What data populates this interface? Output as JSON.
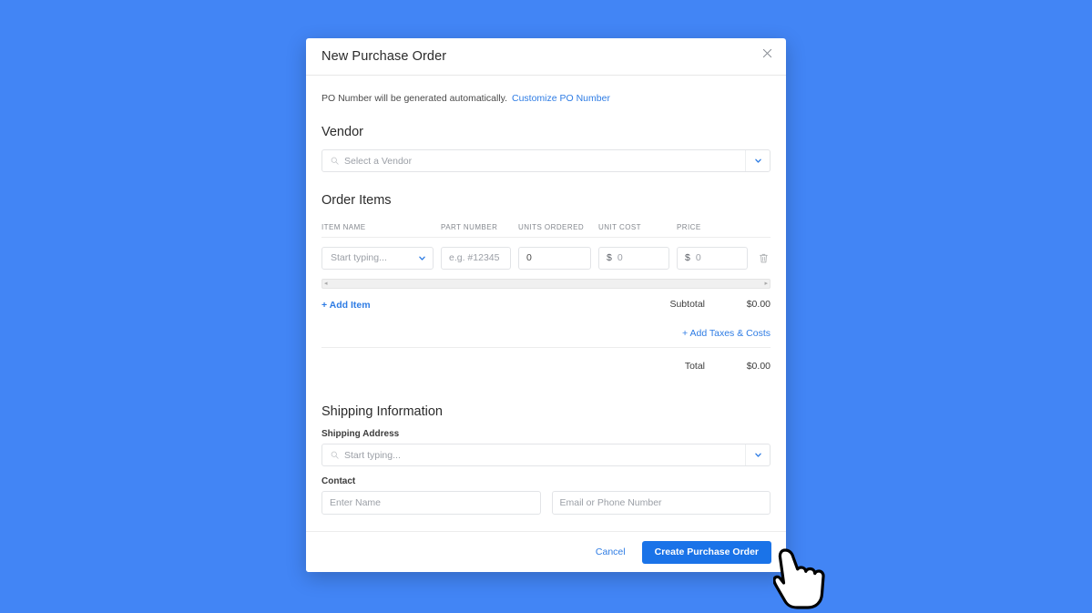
{
  "background_color": "#4285f5",
  "modal": {
    "title": "New Purchase Order",
    "close_icon": "close-icon",
    "po_note": {
      "text": "PO Number will be generated automatically.",
      "link_label": "Customize PO Number"
    },
    "vendor": {
      "section_title": "Vendor",
      "search_icon": "search-icon",
      "placeholder": "Select a Vendor",
      "caret_icon": "chevron-down-icon"
    },
    "order_items": {
      "section_title": "Order Items",
      "columns": [
        "ITEM NAME",
        "PART NUMBER",
        "UNITS ORDERED",
        "UNIT COST",
        "PRICE"
      ],
      "rows": [
        {
          "item_name_placeholder": "Start typing...",
          "part_number_placeholder": "e.g. #12345",
          "units_ordered_value": "0",
          "unit_cost_currency": "$",
          "unit_cost_value": "0",
          "price_currency": "$",
          "price_value": "0",
          "delete_icon": "trash-icon"
        }
      ],
      "scrollbar": {
        "left_arrow": "◂",
        "right_arrow": "▸"
      },
      "add_item_label": "+ Add Item",
      "subtotal_label": "Subtotal",
      "subtotal_value": "$0.00",
      "add_taxes_label": "+ Add Taxes & Costs",
      "total_label": "Total",
      "total_value": "$0.00"
    },
    "shipping": {
      "section_title": "Shipping Information",
      "address_label": "Shipping Address",
      "address_placeholder": "Start typing...",
      "address_search_icon": "search-icon",
      "address_caret_icon": "chevron-down-icon",
      "contact_label": "Contact",
      "contact_name_placeholder": "Enter Name",
      "contact_email_placeholder": "Email or Phone Number"
    },
    "footer": {
      "cancel_label": "Cancel",
      "submit_label": "Create Purchase Order",
      "submit_color": "#1a73e8"
    }
  },
  "cursor": {
    "icon": "pointing-hand-cursor"
  },
  "colors": {
    "link": "#2e7ce4",
    "primary": "#1a73e8",
    "text": "#3c3c3c",
    "muted": "#9b9fa6",
    "border": "#e2e4e7"
  }
}
